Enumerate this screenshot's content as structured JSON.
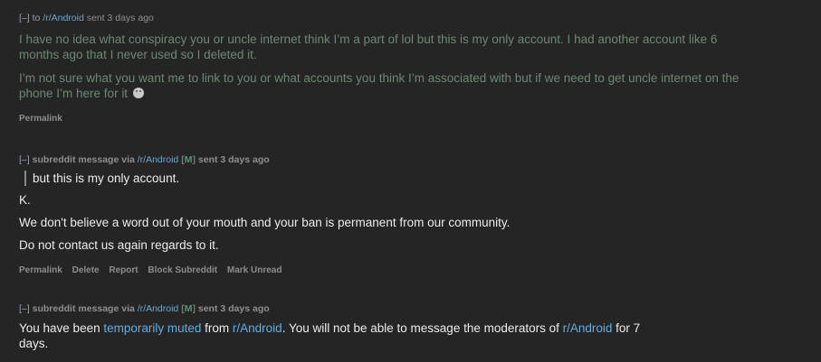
{
  "messages": [
    {
      "toggle": "[–]",
      "to_word": "to",
      "subreddit": "/r/Android",
      "sent": "sent 3 days ago",
      "paragraphs": [
        "I have no idea what conspiracy you or uncle internet think I’m a part of lol but this is my only account. I had another account like 6 months ago that I never used so I deleted it.",
        "I’m not sure what you want me to link to you or what accounts you think I’m associated with but if we need to get uncle internet on the phone I’m here for it"
      ],
      "emoji": "🤣",
      "actions": [
        "Permalink"
      ]
    },
    {
      "toggle": "[–]",
      "label": "subreddit message via",
      "subreddit": "/r/Android",
      "mod_flag_open": "[",
      "mod_flag": "M",
      "mod_flag_close": "]",
      "sent": "sent 3 days ago",
      "quote": "but this is my only account.",
      "paragraphs": [
        "K.",
        "We don't believe a word out of your mouth and your ban is permanent from our community.",
        "Do not contact us again regards to it."
      ],
      "actions": [
        "Permalink",
        "Delete",
        "Report",
        "Block Subreddit",
        "Mark Unread"
      ]
    },
    {
      "toggle": "[–]",
      "label": "subreddit message via",
      "subreddit": "/r/Android",
      "mod_flag_open": "[",
      "mod_flag": "M",
      "mod_flag_close": "]",
      "sent": "sent 3 days ago",
      "text_parts": {
        "p1": "You have been ",
        "link1": "temporarily muted",
        "p2": " from ",
        "link2": "r/Android",
        "p3": ". You will not be able to message the moderators of ",
        "link3": "r/Android",
        "p4": " for 7",
        "p5": "days."
      }
    }
  ]
}
